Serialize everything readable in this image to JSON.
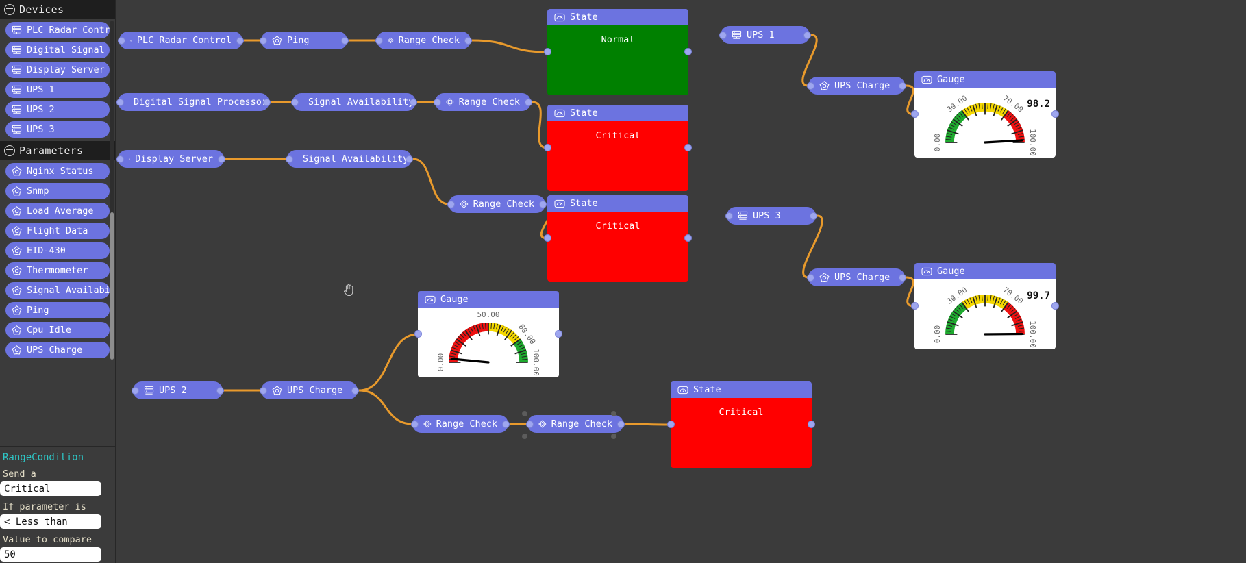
{
  "sidebar": {
    "devices_section": {
      "title": "Devices",
      "items": [
        {
          "label": "PLC Radar Control",
          "icon": "device-icon"
        },
        {
          "label": "Digital Signal Processor",
          "icon": "device-icon"
        },
        {
          "label": "Display Server",
          "icon": "device-icon"
        },
        {
          "label": "UPS 1",
          "icon": "device-icon"
        },
        {
          "label": "UPS 2",
          "icon": "device-icon"
        },
        {
          "label": "UPS 3",
          "icon": "device-icon"
        }
      ]
    },
    "parameters_section": {
      "title": "Parameters",
      "items": [
        {
          "label": "Nginx Status",
          "icon": "gear-icon"
        },
        {
          "label": "Snmp",
          "icon": "gear-icon"
        },
        {
          "label": "Load Average",
          "icon": "gear-icon"
        },
        {
          "label": "Flight Data",
          "icon": "gear-icon"
        },
        {
          "label": "EID-430",
          "icon": "gear-icon"
        },
        {
          "label": "Thermometer",
          "icon": "gear-icon"
        },
        {
          "label": "Signal Availability",
          "icon": "gear-icon"
        },
        {
          "label": "Ping",
          "icon": "gear-icon"
        },
        {
          "label": "Cpu Idle",
          "icon": "gear-icon"
        },
        {
          "label": "UPS Charge",
          "icon": "gear-icon"
        }
      ]
    }
  },
  "inspector": {
    "title": "RangeCondition",
    "field1_label": "Send a",
    "field1_value": "Critical",
    "field2_label": "If parameter is",
    "field2_value": "< Less than",
    "field3_label": "Value to compare",
    "field3_value": "50"
  },
  "graph": {
    "nodes": {
      "plc_radar_control": "PLC Radar Control",
      "ping": "Ping",
      "range_check_1": "Range Check",
      "digital_signal_processor": "Digital Signal Processor",
      "signal_availability_1": "Signal Availability",
      "range_check_2": "Range Check",
      "display_server": "Display Server",
      "signal_availability_2": "Signal Availability",
      "range_check_3": "Range Check",
      "ups1": "UPS 1",
      "ups_charge_1": "UPS Charge",
      "ups3": "UPS 3",
      "ups_charge_3": "UPS Charge",
      "ups2": "UPS 2",
      "ups_charge_2": "UPS Charge",
      "range_check_4": "Range Check",
      "range_check_5": "Range Check"
    },
    "state_nodes": [
      {
        "title": "State",
        "value": "Normal",
        "color": "#008000"
      },
      {
        "title": "State",
        "value": "Critical",
        "color": "#ff0000"
      },
      {
        "title": "State",
        "value": "Critical",
        "color": "#ff0000"
      },
      {
        "title": "State",
        "value": "Critical",
        "color": "#ff0000"
      }
    ],
    "gauges": [
      {
        "title": "Gauge",
        "value": "98.2",
        "ticks": [
          "0.00",
          "30.00",
          "70.00",
          "100.00"
        ],
        "needle_value": 98.2,
        "bands": [
          {
            "from": 0,
            "to": 30,
            "color": "#1faa2f"
          },
          {
            "from": 30,
            "to": 70,
            "color": "#f5d800"
          },
          {
            "from": 70,
            "to": 100,
            "color": "#ee1111"
          }
        ]
      },
      {
        "title": "Gauge",
        "value": "99.7",
        "ticks": [
          "0.00",
          "30.00",
          "70.00",
          "100.00"
        ],
        "needle_value": 99.7,
        "bands": [
          {
            "from": 0,
            "to": 30,
            "color": "#1faa2f"
          },
          {
            "from": 30,
            "to": 70,
            "color": "#f5d800"
          },
          {
            "from": 70,
            "to": 100,
            "color": "#ee1111"
          }
        ]
      },
      {
        "title": "Gauge",
        "value": "",
        "ticks": [
          "0.00",
          "50.00",
          "80.00",
          "100.00"
        ],
        "needle_value": 3,
        "bands": [
          {
            "from": 0,
            "to": 50,
            "color": "#ee1111"
          },
          {
            "from": 50,
            "to": 80,
            "color": "#f5d800"
          },
          {
            "from": 80,
            "to": 100,
            "color": "#1faa2f"
          }
        ]
      }
    ]
  },
  "colors": {
    "node_purple": "#6c73e0",
    "wire_orange": "#e89a2c",
    "canvas_bg": "#3b3b3b",
    "panel_bg": "#1e1e1e",
    "accent_teal": "#2ec6c6"
  }
}
